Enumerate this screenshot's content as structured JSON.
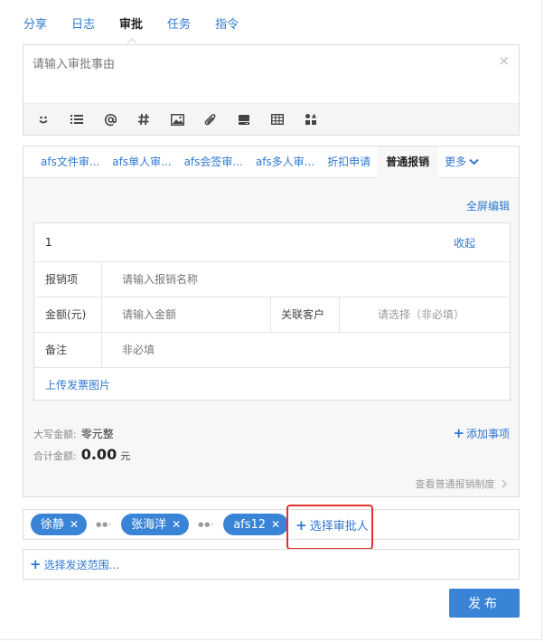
{
  "top_tabs": [
    {
      "label": "分享"
    },
    {
      "label": "日志"
    },
    {
      "label": "审批",
      "active": true
    },
    {
      "label": "任务"
    },
    {
      "label": "指令"
    }
  ],
  "compose": {
    "placeholder": "请输入审批事由",
    "clear_label": "×",
    "toolbar_icons": [
      "emoji-icon",
      "list-icon",
      "mention-icon",
      "hashtag-icon",
      "image-icon",
      "attachment-icon",
      "drive-icon",
      "table-icon",
      "apps-icon"
    ]
  },
  "approval_tabs": [
    {
      "label": "afs文件审..."
    },
    {
      "label": "afs单人审..."
    },
    {
      "label": "afs会签审..."
    },
    {
      "label": "afs多人审..."
    },
    {
      "label": "折扣申请"
    },
    {
      "label": "普通报销",
      "active": true
    },
    {
      "label": "更多"
    }
  ],
  "fullscreen_edit": "全屏编辑",
  "form": {
    "index": "1",
    "collapse": "收起",
    "item_label": "报销项",
    "item_placeholder": "请输入报销名称",
    "amount_label": "金额(元)",
    "amount_placeholder": "请输入金额",
    "customer_label": "关联客户",
    "customer_placeholder": "请选择（非必填）",
    "remark_label": "备注",
    "remark_placeholder": "非必填",
    "upload_invoice": "上传发票图片"
  },
  "totals": {
    "upper_label": "大写金额:",
    "upper_value": "零元整",
    "total_label": "合计金额:",
    "total_value": "0.00",
    "total_unit": "元"
  },
  "add_item": "添加事项",
  "policy_link": "查看普通报销制度",
  "approvers": [
    {
      "name": "徐静"
    },
    {
      "name": "张海洋"
    },
    {
      "name": "afs12"
    }
  ],
  "select_approver": "选择审批人",
  "send_scope": "选择发送范围...",
  "publish": "发布",
  "colors": {
    "link": "#2f78d0",
    "primary": "#3a84d8",
    "highlight_box": "#e53030"
  }
}
